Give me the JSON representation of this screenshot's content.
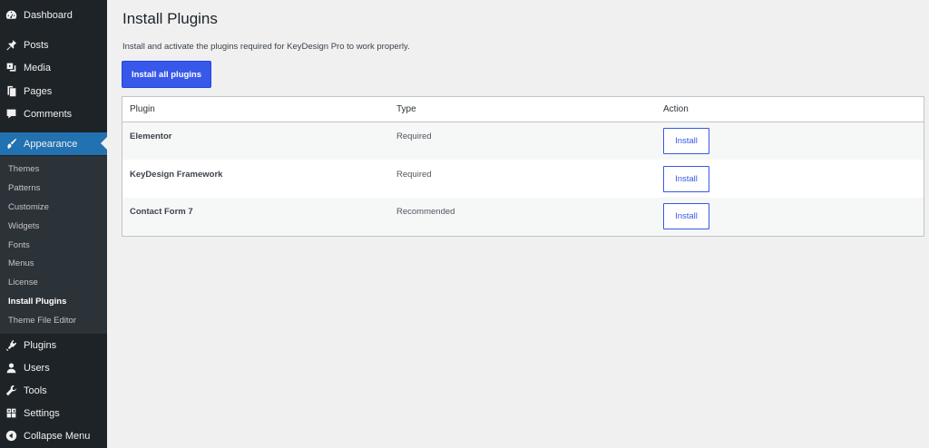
{
  "sidebar": {
    "top_items": [
      {
        "label": "Dashboard",
        "icon": "dashboard-icon"
      },
      {
        "label": "Posts",
        "icon": "pin-icon"
      },
      {
        "label": "Media",
        "icon": "media-icon"
      },
      {
        "label": "Pages",
        "icon": "pages-icon"
      },
      {
        "label": "Comments",
        "icon": "comments-icon"
      },
      {
        "label": "Appearance",
        "icon": "paintbrush-icon"
      }
    ],
    "submenu": [
      "Themes",
      "Patterns",
      "Customize",
      "Widgets",
      "Fonts",
      "Menus",
      "License",
      "Install Plugins",
      "Theme File Editor"
    ],
    "current_submenu": "Install Plugins",
    "bottom_items": [
      {
        "label": "Plugins",
        "icon": "plugins-icon"
      },
      {
        "label": "Users",
        "icon": "users-icon"
      },
      {
        "label": "Tools",
        "icon": "wrench-icon"
      },
      {
        "label": "Settings",
        "icon": "settings-icon"
      },
      {
        "label": "Collapse Menu",
        "icon": "collapse-icon"
      }
    ]
  },
  "main": {
    "title": "Install Plugins",
    "description": "Install and activate the plugins required for KeyDesign Pro to work properly.",
    "install_all_label": "Install all plugins",
    "table": {
      "headers": [
        "Plugin",
        "Type",
        "Action"
      ],
      "rows": [
        {
          "plugin": "Elementor",
          "type": "Required",
          "action": "Install"
        },
        {
          "plugin": "KeyDesign Framework",
          "type": "Required",
          "action": "Install"
        },
        {
          "plugin": "Contact Form 7",
          "type": "Recommended",
          "action": "Install"
        }
      ]
    }
  },
  "colors": {
    "sidebar_bg": "#1d2327",
    "active_bg": "#2271b1",
    "accent": "#3858e9",
    "page_bg": "#f0f0f1"
  }
}
